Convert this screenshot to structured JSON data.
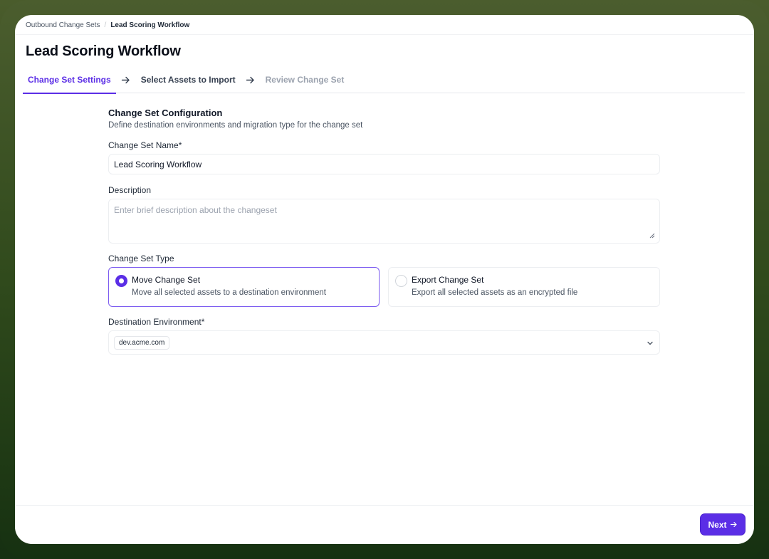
{
  "breadcrumb": {
    "parent": "Outbound Change Sets",
    "separator": "/",
    "current": "Lead Scoring Workflow"
  },
  "page": {
    "title": "Lead Scoring Workflow"
  },
  "steps": [
    {
      "label": "Change Set Settings",
      "state": "active"
    },
    {
      "label": "Select Assets to Import",
      "state": "default"
    },
    {
      "label": "Review Change Set",
      "state": "disabled"
    }
  ],
  "form": {
    "section_title": "Change Set Configuration",
    "section_subtitle": "Define destination environments and migration type for the change set",
    "name_label": "Change Set Name*",
    "name_value": "Lead Scoring Workflow",
    "description_label": "Description",
    "description_placeholder": "Enter brief description about the changeset",
    "type_label": "Change Set Type",
    "type_options": [
      {
        "title": "Move Change Set",
        "description": "Move all selected assets to a destination environment",
        "selected": true
      },
      {
        "title": "Export Change Set",
        "description": "Export all selected assets as an encrypted file",
        "selected": false
      }
    ],
    "destination_label": "Destination Environment*",
    "destination_value": "dev.acme.com"
  },
  "footer": {
    "next_label": "Next"
  },
  "colors": {
    "accent": "#5b2ee6",
    "background_top": "#4b5d2e",
    "background_bottom": "#163111"
  },
  "icons": {
    "step_separator": "arrow-right-icon",
    "dropdown": "chevron-down-icon",
    "next": "arrow-right-icon"
  }
}
